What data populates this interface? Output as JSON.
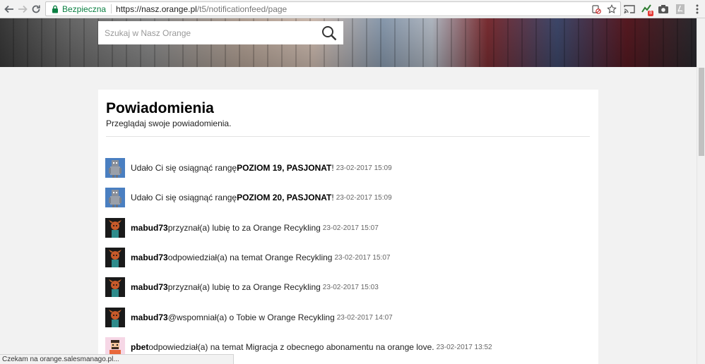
{
  "browser": {
    "security_label": "Bezpieczna",
    "url_host": "https://nasz.orange.pl",
    "url_path": "/t5/notificationfeed/page",
    "extension_badge": "8",
    "status_text": "Czekam na orange.salesmanago.pl..."
  },
  "search": {
    "placeholder": "Szukaj w Nasz Orange"
  },
  "page": {
    "title": "Powiadomienia",
    "subtitle": "Przeglądaj swoje powiadomienia."
  },
  "notifications": [
    {
      "avatar": "robot-avatar",
      "prefix": "",
      "actor": "",
      "text": "Udało Ci się osiągnąć rangę ",
      "bold": "POZIOM 19, PASJONAT",
      "suffix": "!",
      "time": "23-02-2017 15:09"
    },
    {
      "avatar": "robot-avatar",
      "prefix": "",
      "actor": "",
      "text": "Udało Ci się osiągnąć rangę ",
      "bold": "POZIOM 20, PASJONAT",
      "suffix": "!",
      "time": "23-02-2017 15:09"
    },
    {
      "avatar": "character-avatar",
      "actor": "mabud73",
      "text": " przyznał(a) lubię to za Orange Recykling",
      "bold": "",
      "suffix": "",
      "time": "23-02-2017 15:07"
    },
    {
      "avatar": "character-avatar",
      "actor": "mabud73",
      "text": " odpowiedział(a) na temat Orange Recykling",
      "bold": "",
      "suffix": "",
      "time": "23-02-2017 15:07"
    },
    {
      "avatar": "character-avatar",
      "actor": "mabud73",
      "text": " przyznał(a) lubię to za Orange Recykling",
      "bold": "",
      "suffix": "",
      "time": "23-02-2017 15:03"
    },
    {
      "avatar": "character-avatar",
      "actor": "mabud73",
      "text": " @wspomniał(a) o Tobie w Orange Recykling",
      "bold": "",
      "suffix": "",
      "time": "23-02-2017 14:07"
    },
    {
      "avatar": "person-avatar",
      "actor": "pbet",
      "text": " odpowiedział(a) na temat Migracja z obecnego abonamentu na orange love.",
      "bold": "",
      "suffix": "",
      "time": "23-02-2017 13:52"
    }
  ],
  "colors": {
    "secure_green": "#0b8043",
    "accent_badge": "#e53935"
  }
}
